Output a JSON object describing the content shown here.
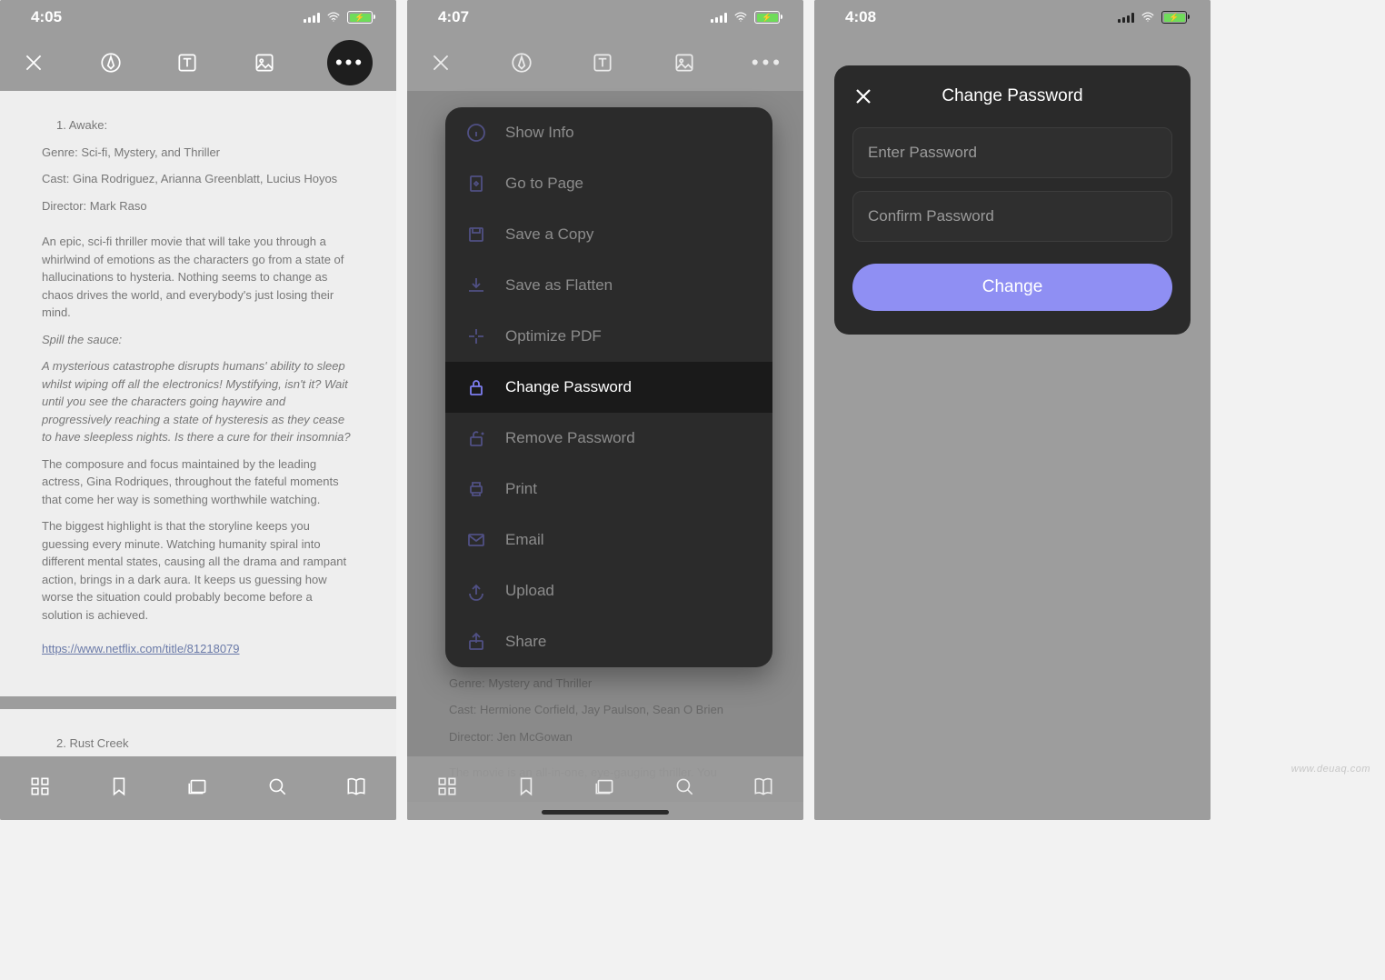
{
  "statusbar": {
    "time1": "4:05",
    "time2": "4:07",
    "time3": "4:08"
  },
  "toolbar": {
    "close": "close-icon",
    "pen": "pen-icon",
    "text": "text-tool-icon",
    "image": "image-tool-icon",
    "more": "more-icon"
  },
  "document": {
    "item1_num": "1. Awake:",
    "item1_genre": "Genre: Sci-fi, Mystery, and Thriller",
    "item1_cast": "Cast: Gina Rodriguez, Arianna Greenblatt, Lucius Hoyos",
    "item1_director": "Director: Mark Raso",
    "item1_p1": "An epic, sci-fi thriller movie that will take you through a whirlwind of emotions as the characters go from a state of hallucinations to hysteria. Nothing seems to change as chaos drives the world, and everybody's just losing their mind.",
    "item1_spill": "Spill the sauce:",
    "item1_em": "A mysterious catastrophe disrupts humans' ability to sleep whilst wiping off all the electronics! Mystifying, isn't it? Wait until you see the characters going haywire and progressively reaching a state of hysteresis as they cease to have sleepless nights. Is there a cure for their insomnia?",
    "item1_p2": "The composure and focus maintained by the leading actress, Gina Rodriques, throughout the fateful moments that come her way is something worthwhile watching.",
    "item1_p3": "The biggest highlight is that the storyline keeps you guessing every minute. Watching humanity spiral into different mental states, causing all the drama and rampant action, brings in a dark aura. It keeps us guessing how worse the situation could probably become before a solution is achieved.",
    "item1_link": "https://www.netflix.com/title/81218079",
    "item2_num": "2. Rust Creek",
    "item2_genre": "Genre: Mystery and Thriller",
    "item2_cast": "Cast: Hermione Corfield, Jay Paulson, Sean O Brien",
    "item2_director": "Director: Jen McGowan",
    "item2_p1": "The movie is an all-in-one, eye-gauging thriller. You"
  },
  "tabbar": {
    "grid": "grid-icon",
    "bookmark": "bookmark-icon",
    "pages": "thumbnails-icon",
    "search": "search-icon",
    "book": "book-icon"
  },
  "menu": {
    "items": [
      {
        "icon": "info-icon",
        "label": "Show Info",
        "highlighted": false
      },
      {
        "icon": "goto-page-icon",
        "label": "Go to Page",
        "highlighted": false
      },
      {
        "icon": "save-copy-icon",
        "label": "Save a Copy",
        "highlighted": false
      },
      {
        "icon": "flatten-icon",
        "label": "Save as Flatten",
        "highlighted": false
      },
      {
        "icon": "optimize-icon",
        "label": "Optimize PDF",
        "highlighted": false
      },
      {
        "icon": "lock-icon",
        "label": "Change Password",
        "highlighted": true
      },
      {
        "icon": "unlock-icon",
        "label": "Remove Password",
        "highlighted": false
      },
      {
        "icon": "print-icon",
        "label": "Print",
        "highlighted": false
      },
      {
        "icon": "email-icon",
        "label": "Email",
        "highlighted": false
      },
      {
        "icon": "upload-icon",
        "label": "Upload",
        "highlighted": false
      },
      {
        "icon": "share-icon",
        "label": "Share",
        "highlighted": false
      }
    ]
  },
  "modal": {
    "title": "Change Password",
    "enter_placeholder": "Enter Password",
    "confirm_placeholder": "Confirm Password",
    "button": "Change"
  },
  "watermark": "www.deuaq.com"
}
